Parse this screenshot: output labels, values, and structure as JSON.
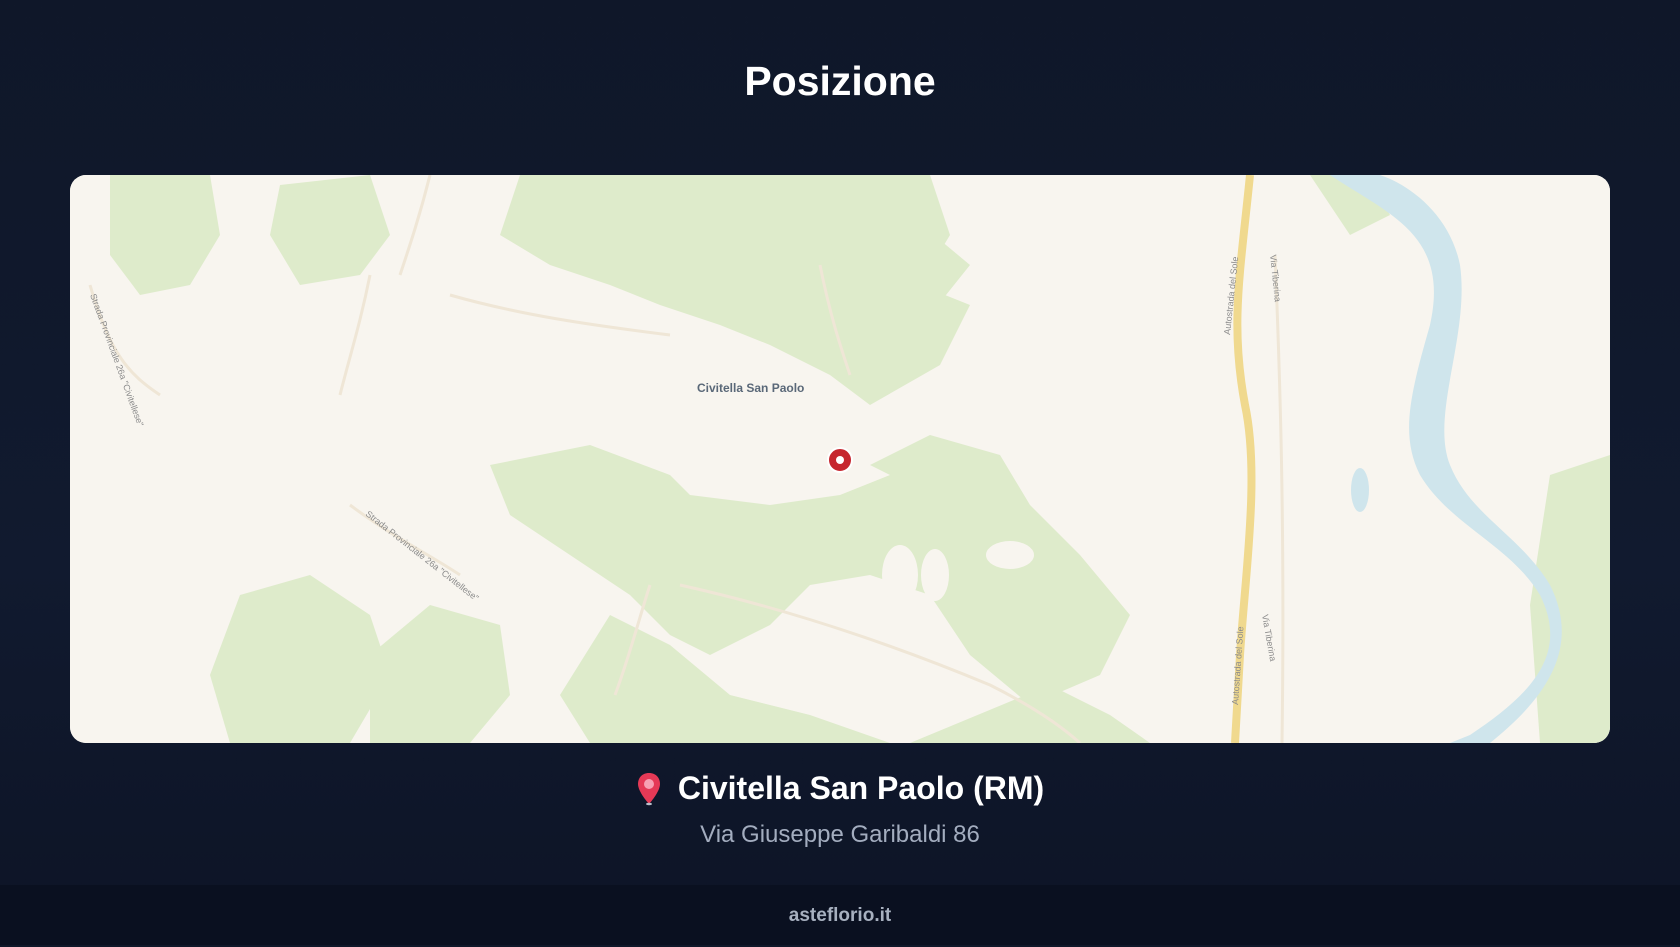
{
  "page": {
    "title": "Posizione"
  },
  "map": {
    "place_label": "Civitella San Paolo",
    "road_labels": [
      "Autostrada del Sole",
      "Via Tiberina",
      "Strada Provinciale 26a \"Civitellese\""
    ],
    "marker_icon": "location-marker-icon",
    "colors": {
      "land": "#f8f5ef",
      "forest": "#dfeccc",
      "water": "#cfe6ee",
      "highway": "#f2d98a",
      "marker": "#c6262e"
    }
  },
  "location": {
    "icon": "pin-icon",
    "name": "Civitella San Paolo (RM)",
    "address": "Via Giuseppe Garibaldi 86"
  },
  "footer": {
    "site": "asteflorio.it"
  }
}
